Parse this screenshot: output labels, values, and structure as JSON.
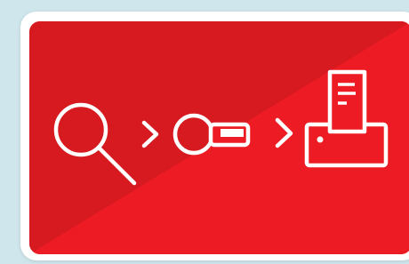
{
  "colors": {
    "background": "#cfe6ec",
    "frame": "#ffffff",
    "card_red": "#ed1c24",
    "card_dark_red": "#d71920",
    "icon_stroke": "#ffffff"
  },
  "flow": {
    "steps": [
      {
        "icon": "magnifier-icon"
      },
      {
        "icon": "key-card-icon"
      },
      {
        "icon": "printer-icon"
      }
    ],
    "separators": [
      "chevron-right-icon",
      "chevron-right-icon"
    ]
  }
}
